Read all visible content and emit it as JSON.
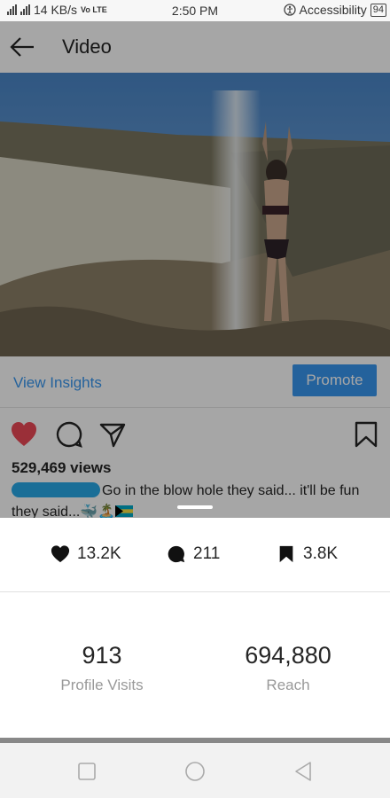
{
  "status_bar": {
    "network": "4G",
    "speed": "14 KB/s",
    "volte": "Vo LTE",
    "time": "2:50 PM",
    "accessibility": "Accessibility",
    "battery": "94"
  },
  "header": {
    "title": "Video",
    "back_icon": "arrow-left-icon"
  },
  "insights": {
    "view_label": "View Insights",
    "promote_label": "Promote"
  },
  "post": {
    "views": "529,469 views",
    "caption": "Go in the blow hole they said... it'll be fun they said...",
    "emojis": [
      "🐳",
      "🏝️"
    ]
  },
  "metrics": {
    "likes": "13.2K",
    "comments": "211",
    "saves": "3.8K"
  },
  "stats": {
    "profile_visits_value": "913",
    "profile_visits_label": "Profile Visits",
    "reach_value": "694,880",
    "reach_label": "Reach"
  },
  "colors": {
    "accent": "#3897f0",
    "like": "#ed4956"
  }
}
